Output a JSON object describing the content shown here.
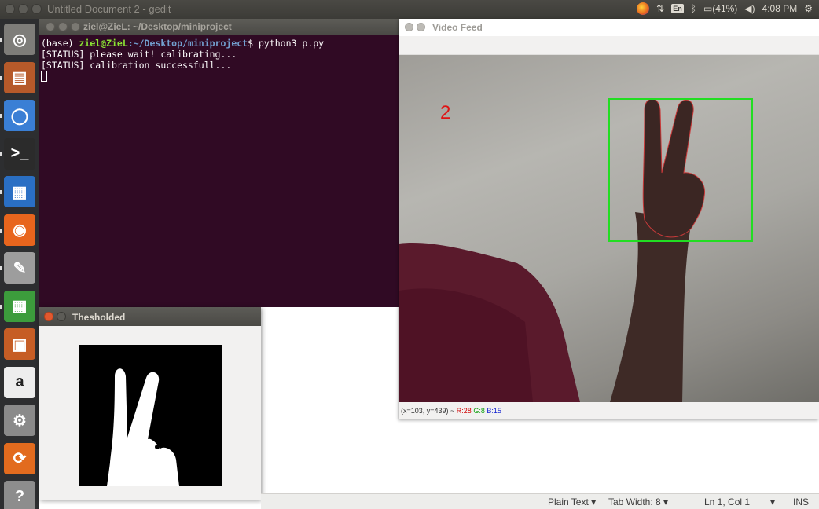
{
  "top_panel": {
    "window_title": "Untitled Document 2 - gedit",
    "keyboard_layout": "En",
    "battery": "(41%)",
    "time": "4:08 PM"
  },
  "launcher": {
    "items": [
      {
        "name": "ubuntu-dash",
        "icon": "ubuntu-logo-icon",
        "color": "#7e7d79"
      },
      {
        "name": "files",
        "icon": "file-cabinet-icon",
        "color": "#b65a2a"
      },
      {
        "name": "chromium",
        "icon": "chromium-icon",
        "color": "#3a7fd5"
      },
      {
        "name": "terminal",
        "icon": "terminal-icon",
        "color": "#2b2b2b"
      },
      {
        "name": "libreoffice-writer",
        "icon": "writer-doc-icon",
        "color": "#2a6fc4"
      },
      {
        "name": "firefox",
        "icon": "firefox-icon",
        "color": "#e8651d"
      },
      {
        "name": "text-editor",
        "icon": "text-editor-icon",
        "color": "#9d9d9d"
      },
      {
        "name": "libreoffice-calc",
        "icon": "calc-sheet-icon",
        "color": "#3c9c3c"
      },
      {
        "name": "libreoffice-impress",
        "icon": "impress-slides-icon",
        "color": "#c65d25"
      },
      {
        "name": "amazon",
        "icon": "amazon-icon",
        "color": "#ededed"
      },
      {
        "name": "system-settings",
        "icon": "settings-gear-icon",
        "color": "#8a8a8a"
      },
      {
        "name": "software-updater",
        "icon": "updater-icon",
        "color": "#e26b1e"
      },
      {
        "name": "help",
        "icon": "help-icon",
        "color": "#8d8d8d"
      }
    ]
  },
  "terminal": {
    "title": "ziel@ZieL: ~/Desktop/miniproject",
    "prompt_env": "(base) ",
    "prompt_user": "ziel@ZieL",
    "prompt_path": ":~/Desktop/miniproject",
    "prompt_symbol": "$ ",
    "command": "python3 p.py",
    "lines": [
      "[STATUS] please wait! calibrating...",
      "[STATUS] calibration successfull..."
    ]
  },
  "video_feed": {
    "title": "Video Feed",
    "finger_count": "2",
    "status_coords": "(x=103, y=439) ~ ",
    "status_r": "R:28",
    "status_g": "G:8",
    "status_b": "B:15"
  },
  "threshold_window": {
    "title": "Thesholded"
  },
  "gedit_status": {
    "language": "Plain Text",
    "tab_width": "Tab Width: 8",
    "position": "Ln 1, Col 1",
    "mode": "INS"
  }
}
